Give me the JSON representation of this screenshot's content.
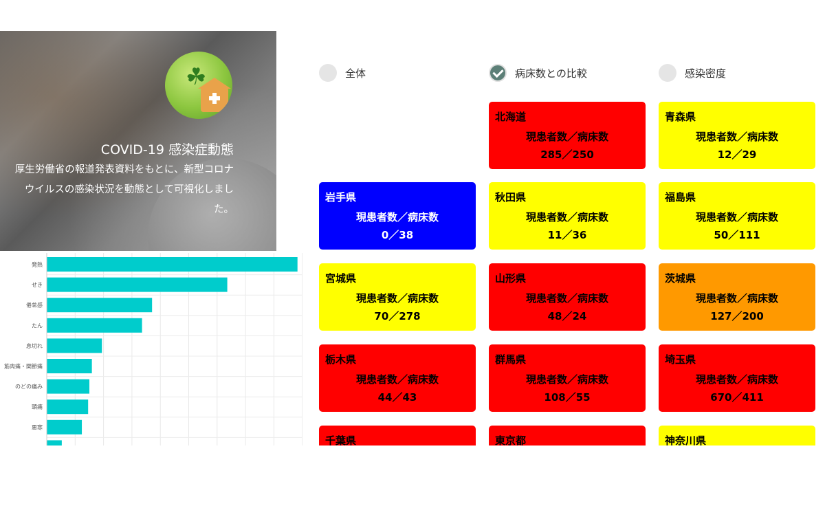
{
  "colors": {
    "red": "#ff0000",
    "yellow": "#ffff00",
    "orange": "#ff9900",
    "blue": "#0000ff",
    "bar": "#00cccc"
  },
  "hero": {
    "title": "COVID-19 感染症動態",
    "description": "厚生労働省の報道発表資料をもとに、新型コロナウイルスの感染状況を動態として可視化しました。",
    "logo_icon": "clover-house-logo"
  },
  "tabs": [
    {
      "label": "全体",
      "checked": false
    },
    {
      "label": "病床数との比較",
      "checked": true
    },
    {
      "label": "感染密度",
      "checked": false
    }
  ],
  "card_label": "現患者数／病床数",
  "cards": [
    {
      "name": "北海道",
      "value": "285／250",
      "color": "red"
    },
    {
      "name": "青森県",
      "value": "12／29",
      "color": "yellow"
    },
    {
      "name": "岩手県",
      "value": "0／38",
      "color": "blue"
    },
    {
      "name": "秋田県",
      "value": "11／36",
      "color": "yellow"
    },
    {
      "name": "福島県",
      "value": "50／111",
      "color": "yellow"
    },
    {
      "name": "宮城県",
      "value": "70／278",
      "color": "yellow"
    },
    {
      "name": "山形県",
      "value": "48／24",
      "color": "red"
    },
    {
      "name": "茨城県",
      "value": "127／200",
      "color": "orange"
    },
    {
      "name": "栃木県",
      "value": "44／43",
      "color": "red"
    },
    {
      "name": "群馬県",
      "value": "108／55",
      "color": "red"
    },
    {
      "name": "埼玉県",
      "value": "670／411",
      "color": "red"
    },
    {
      "name": "千葉県",
      "value": "",
      "color": "red"
    },
    {
      "name": "東京都",
      "value": "",
      "color": "red"
    },
    {
      "name": "神奈川県",
      "value": "",
      "color": "yellow"
    }
  ],
  "chart_data": {
    "type": "bar",
    "orientation": "horizontal",
    "categories": [
      "発熱",
      "せき",
      "倦怠感",
      "たん",
      "息切れ",
      "筋肉痛・関節痛",
      "のどの痛み",
      "頭痛",
      "悪寒",
      ""
    ],
    "values": [
      100,
      72,
      42,
      38,
      22,
      18,
      17,
      16.5,
      14,
      6
    ],
    "xlim": [
      0,
      102
    ],
    "grid": true,
    "title": "",
    "xlabel": "",
    "ylabel": ""
  }
}
